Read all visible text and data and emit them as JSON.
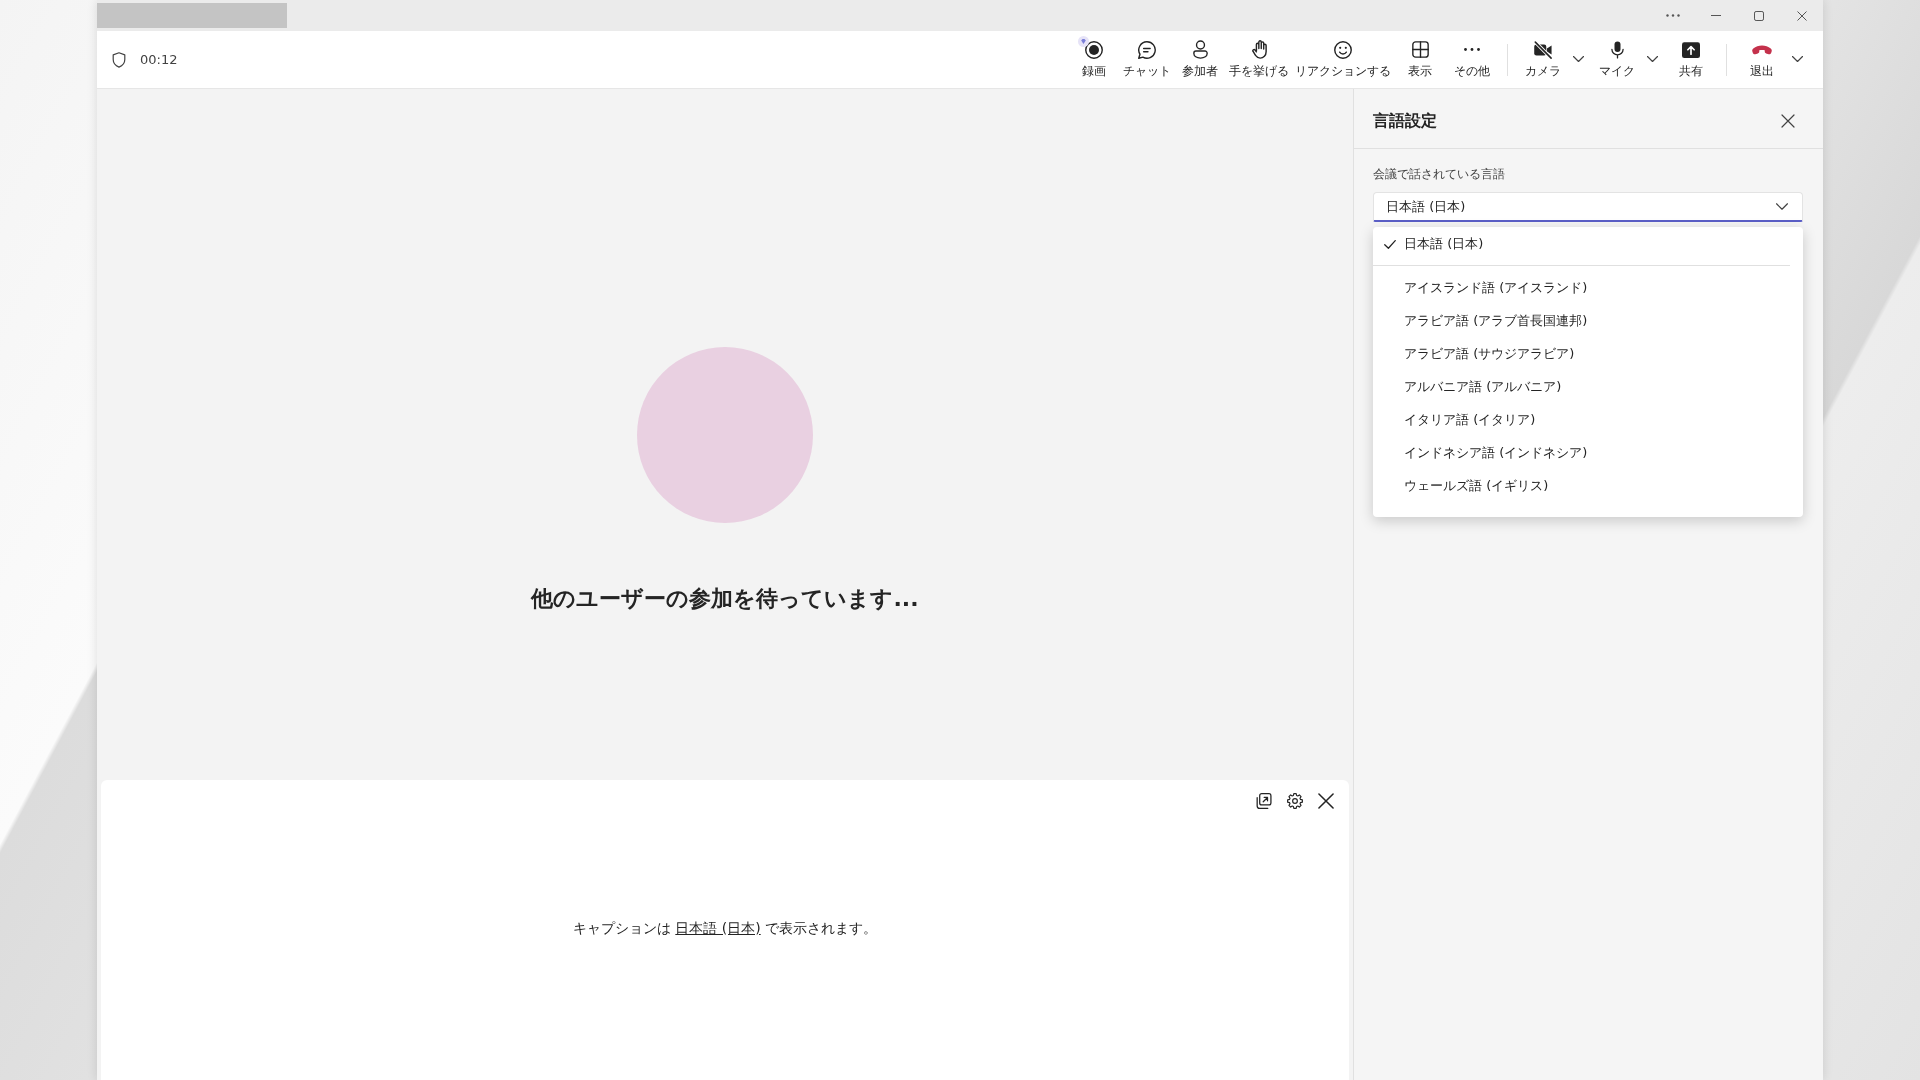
{
  "meeting_toolbar": {
    "timer": "00:12",
    "actions": [
      {
        "label": "録画",
        "kind": "record"
      },
      {
        "label": "チャット",
        "kind": "chat"
      },
      {
        "label": "参加者",
        "kind": "people"
      },
      {
        "label": "手を挙げる",
        "kind": "hand"
      },
      {
        "label": "リアクションする",
        "kind": "react"
      },
      {
        "label": "表示",
        "kind": "view"
      },
      {
        "label": "その他",
        "kind": "more"
      }
    ],
    "devices": [
      {
        "label": "カメラ",
        "kind": "camera",
        "on": false,
        "has_menu": true
      },
      {
        "label": "マイク",
        "kind": "mic",
        "on": true,
        "has_menu": true
      },
      {
        "label": "共有",
        "kind": "share",
        "on": false,
        "has_menu": false
      }
    ],
    "leave": {
      "label": "退出",
      "has_menu": true
    }
  },
  "stage": {
    "status": "他のユーザーの参加を待っています..."
  },
  "captions": {
    "text_before": "キャプションは ",
    "language_link": "日本語 (日本)",
    "text_after": " で表示されます。"
  },
  "language_panel": {
    "title": "言語設定",
    "field_label": "会議で話されている言語",
    "spoken_language": {
      "value": "日本語 (日本)",
      "expanded": true
    },
    "options": [
      {
        "label": "日本語 (日本)",
        "selected": true
      },
      {
        "label": "アイスランド語 (アイスランド)",
        "selected": false
      },
      {
        "label": "アラビア語 (アラブ首長国連邦)",
        "selected": false
      },
      {
        "label": "アラビア語 (サウジアラビア)",
        "selected": false
      },
      {
        "label": "アルバニア語 (アルバニア)",
        "selected": false
      },
      {
        "label": "イタリア語 (イタリア)",
        "selected": false
      },
      {
        "label": "インドネシア語 (インドネシア)",
        "selected": false
      },
      {
        "label": "ウェールズ語 (イギリス)",
        "selected": false
      }
    ]
  }
}
